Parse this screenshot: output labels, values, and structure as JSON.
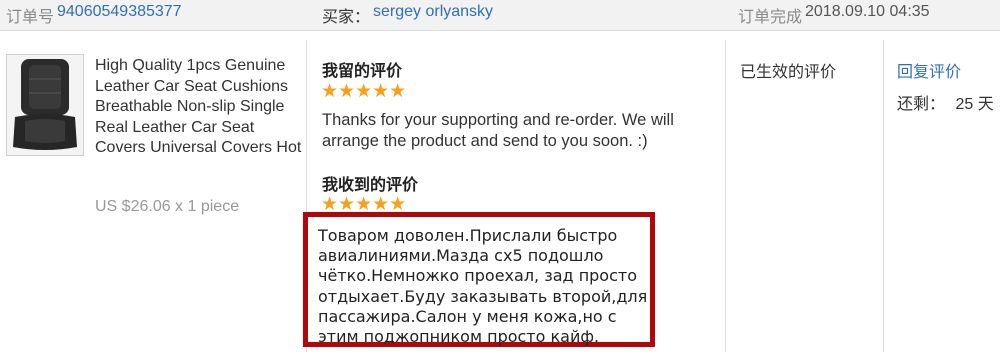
{
  "order": {
    "number_label": "订单号",
    "number": "94060549385377",
    "buyer_label": "买家：",
    "buyer_name": "sergey orlyansky",
    "completed_label": "订单完成",
    "completed_time": "2018.09.10 04:35"
  },
  "product": {
    "title": "High Quality 1pcs Genuine Leather Car Seat Cushions Breathable Non-slip Single Real Leather Car Seat Covers Universal Covers Hot",
    "price": "US $26.06 x 1 piece",
    "thumbnail_icon": "seat-cushion-image"
  },
  "my_review": {
    "heading": "我留的评价",
    "stars": "★★★★★",
    "text": "Thanks for your supporting and re-order. We will arrange the product and send to you soon. :)"
  },
  "received_review": {
    "heading": "我收到的评价",
    "stars": "★★★★★",
    "text": "Товаром доволен.Прислали быстро авиалиниями.Мазда сх5 подошло чётко.Немножко проехал, зад просто отдыхает.Буду заказывать второй,для пассажира.Салон у меня кожа,но с этим поджопником просто кайф."
  },
  "status": {
    "label": "已生效的评价"
  },
  "actions": {
    "reply_label": "回复评价",
    "remaining_label": "还剩：",
    "remaining_value": "25 天"
  },
  "colors": {
    "link": "#2f6fb8",
    "highlight_border": "#b1070b",
    "star": "#f7a11a"
  }
}
